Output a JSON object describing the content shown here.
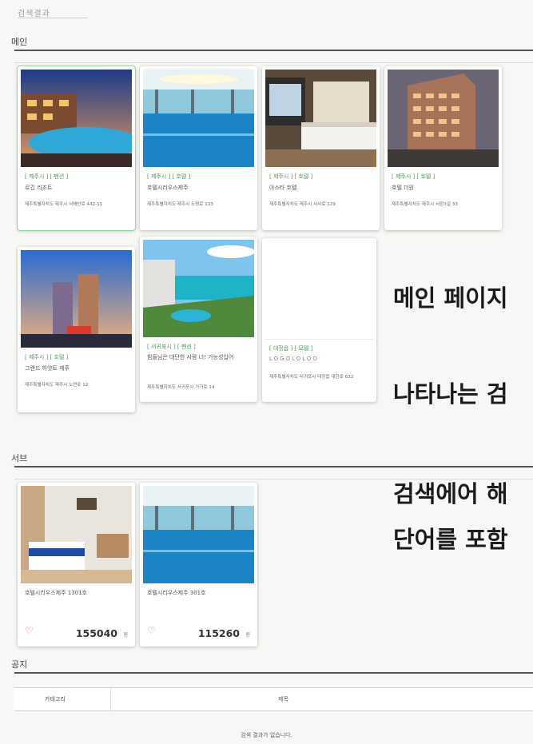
{
  "page": {
    "title": "검색결과"
  },
  "sections": {
    "main": {
      "label": "메인"
    },
    "sub": {
      "label": "서브"
    },
    "notice": {
      "label": "공지"
    }
  },
  "main_cards": [
    {
      "tags": "[ 제주시 ] [ 펜션 ]",
      "name": "로긴 리조트",
      "addr": "제주특별자치도 제주시 서해안로 442-11"
    },
    {
      "tags": "[ 제주시 ] [ 호텔 ]",
      "name": "호텔시리우스제주",
      "addr": "제주특별자치도 제주시 도령로 133"
    },
    {
      "tags": "[ 제주시 ] [ 호텔 ]",
      "name": "아스타 호텔",
      "addr": "제주특별자치도 제주시 서사로 129"
    },
    {
      "tags": "[ 제주시 ] [ 호텔 ]",
      "name": "호텔 더원",
      "addr": "제주특별자치도 제주시 서광3길 33"
    },
    {
      "tags": "[ 제주시 ] [ 호텔 ]",
      "name": "그랜드 하얏트 제주",
      "addr": "제주특별자치도 제주시 노연로 12"
    },
    {
      "tags": "[ 서귀포시 ] [ 펜션 ]",
      "name": "힘들님은 대단한 사람 너! 가능성입어",
      "addr": "제주특별자치도 서귀포시 가가로 14"
    },
    {
      "tags": "[ 대정읍 ] [ 모텔 ]",
      "name": "LOGOLOLOO",
      "addr": "제주특별자치도 서귀포시 대정읍 대한로 632"
    }
  ],
  "sub_cards": [
    {
      "name": "호텔시리우스제주 1301호",
      "price": "155040",
      "unit": "원"
    },
    {
      "name": "호텔시리우스제주 301호",
      "price": "115260",
      "unit": "원"
    }
  ],
  "overlay": {
    "line1": "메인 페이지",
    "line2": "나타나는 검",
    "line3": "검색에어 해",
    "line4": "단어를 포함"
  },
  "notice_table": {
    "col_category": "카테고리",
    "col_title": "제목",
    "empty": "검색 결과가 없습니다."
  },
  "colors": {
    "tag_green": "#4c9a63",
    "heart_pink": "#e47b86",
    "rule": "#555555"
  },
  "icons": {
    "heart": "heart-outline-icon"
  }
}
